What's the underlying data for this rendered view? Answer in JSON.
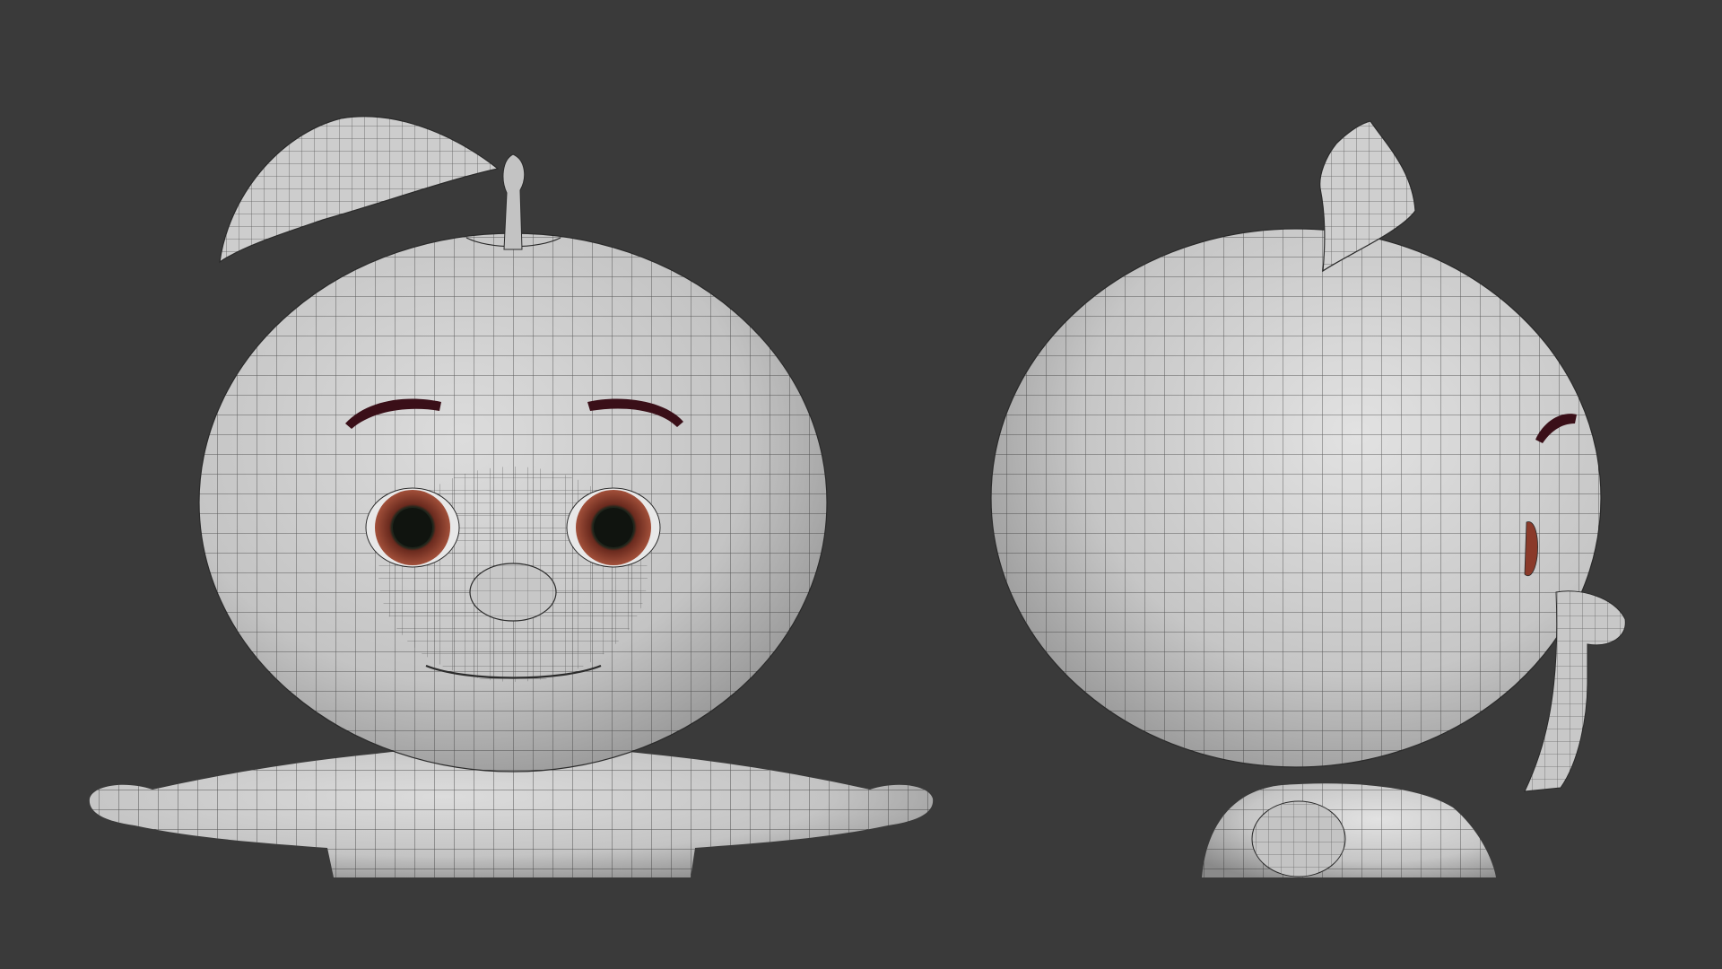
{
  "scene": {
    "background": "#3a3a3a",
    "views": [
      {
        "id": "front",
        "subject": "apple-character-head-front-view"
      },
      {
        "id": "side",
        "subject": "apple-character-head-side-view"
      }
    ],
    "colors": {
      "mesh_fill": "#c9c9c9",
      "mesh_shadow": "#8e8e8e",
      "wire": "#2b2b2b",
      "brow": "#3a0f18",
      "iris": "#8a3a2a",
      "pupil": "#10140f"
    }
  }
}
